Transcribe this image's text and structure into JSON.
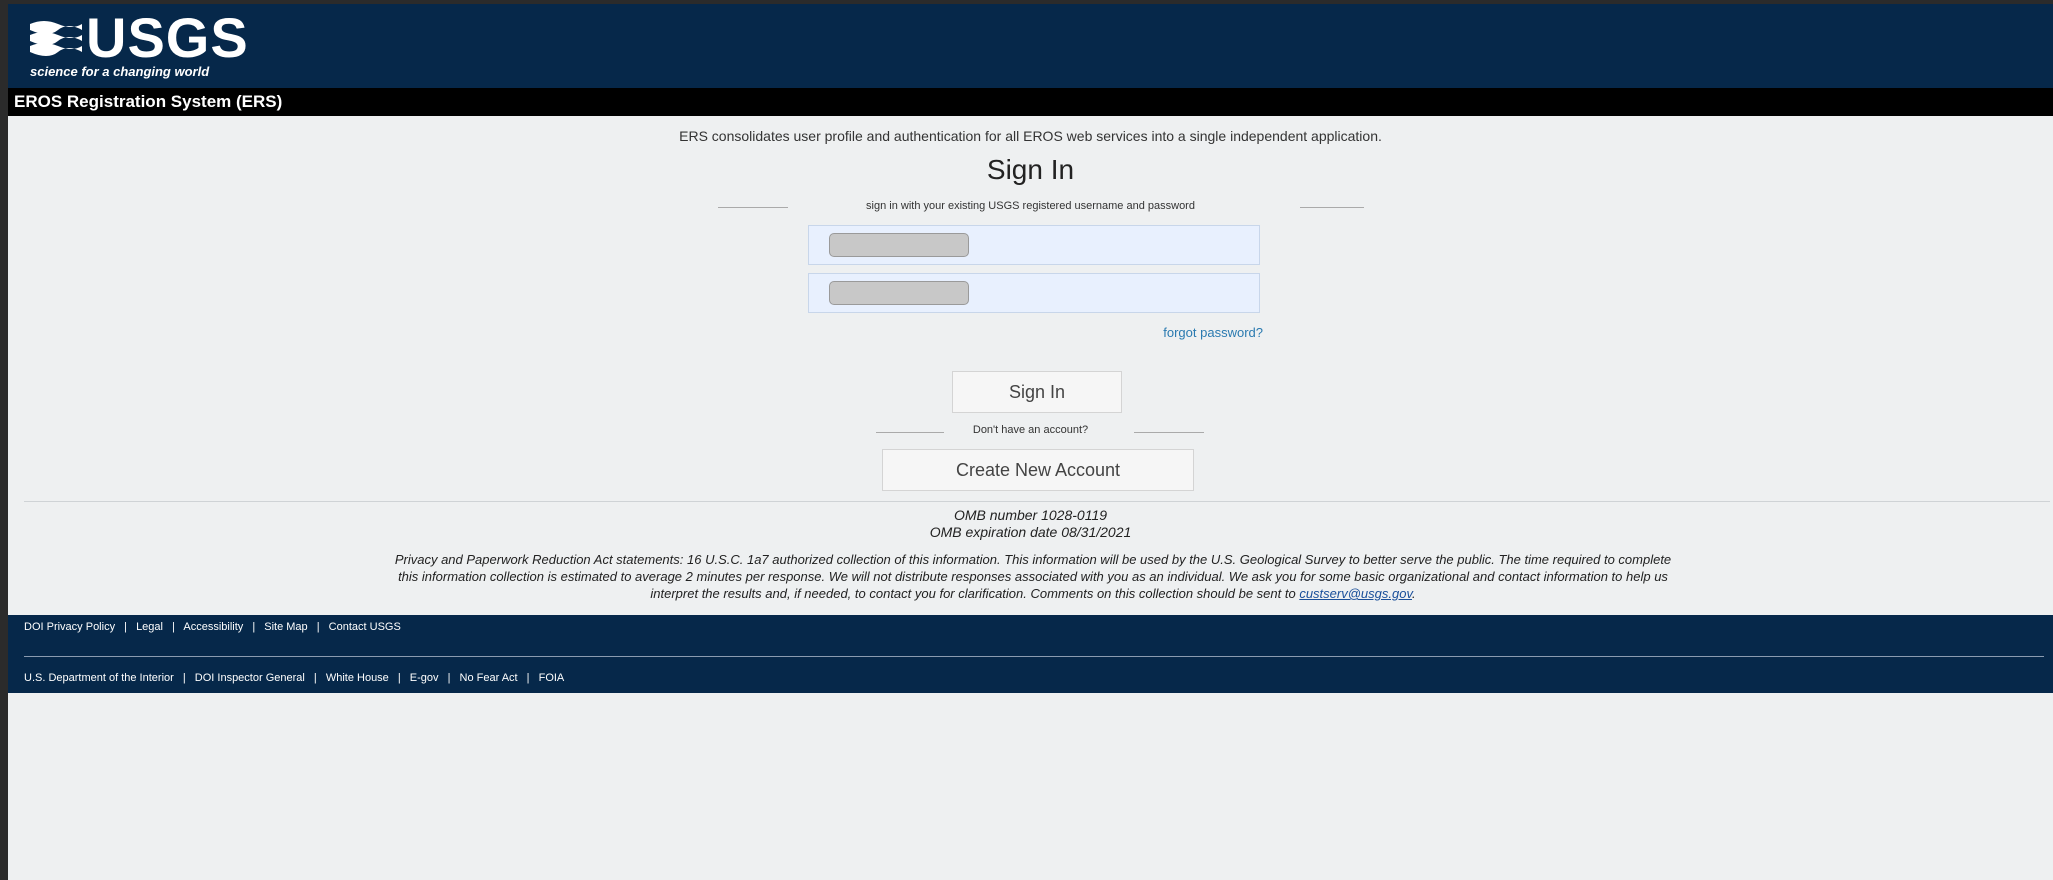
{
  "header": {
    "logo_text": "USGS",
    "tagline": "science for a changing world"
  },
  "app_bar": {
    "title": "EROS Registration System (ERS)"
  },
  "main": {
    "intro": "ERS consolidates user profile and authentication for all EROS web services into a single independent application.",
    "title": "Sign In",
    "subtitle": "sign in with your existing USGS registered username and password",
    "username": {
      "value": "",
      "placeholder": ""
    },
    "password": {
      "value": "",
      "placeholder": ""
    },
    "forgot_password": "forgot password?",
    "signin_button": "Sign In",
    "no_account": "Don't have an account?",
    "create_account_button": "Create New Account"
  },
  "omb": {
    "number": "OMB number 1028-0119",
    "expiration": "OMB expiration date 08/31/2021"
  },
  "privacy": {
    "line1": "Privacy and Paperwork Reduction Act statements: 16 U.S.C. 1a7 authorized collection of this information. This information will be used by the U.S. Geological Survey to better serve the public. The time required to complete",
    "line2": "this information collection is estimated to average 2 minutes per response. We will not distribute responses associated with you as an individual. We ask you for some basic organizational and contact information to help us",
    "line3": "interpret the results and, if needed, to contact you for clarification. Comments on this collection should be sent to",
    "email": "custserv@usgs.gov"
  },
  "footer": {
    "row1": [
      "DOI Privacy Policy",
      "Legal",
      "Accessibility",
      "Site Map",
      "Contact USGS"
    ],
    "row2": [
      "U.S. Department of the Interior",
      "DOI Inspector General",
      "White House",
      "E-gov",
      "No Fear Act",
      "FOIA"
    ],
    "separator": "|"
  },
  "colors": {
    "header_bg": "#06284a",
    "app_bar_bg": "#000000",
    "page_bg": "#eef0f1",
    "link": "#2a7ab0"
  }
}
